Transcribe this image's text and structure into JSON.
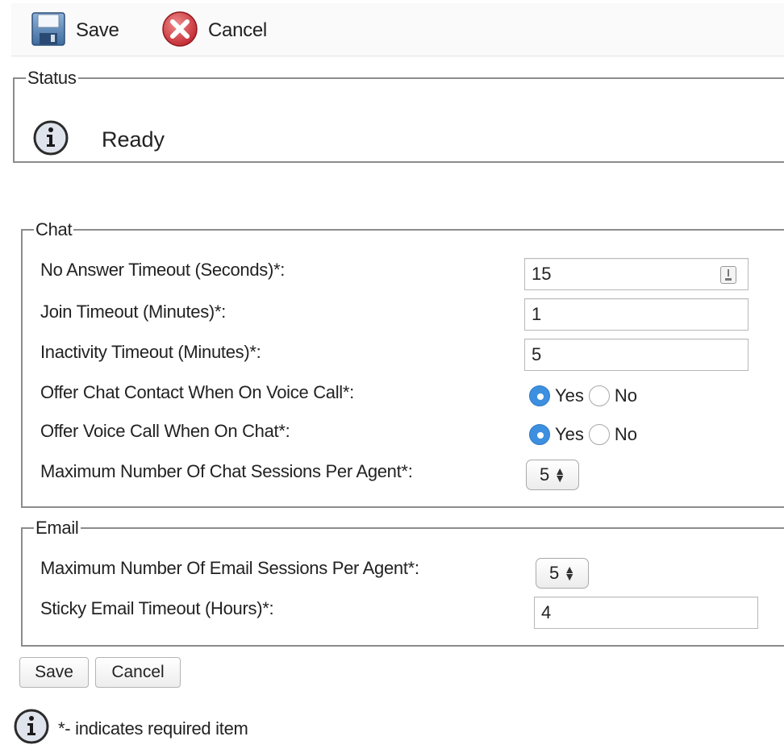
{
  "toolbar": {
    "save_label": "Save",
    "cancel_label": "Cancel"
  },
  "status": {
    "legend": "Status",
    "text": "Ready"
  },
  "chat": {
    "legend": "Chat",
    "no_answer_label": "No Answer Timeout (Seconds)*:",
    "no_answer_value": "15",
    "join_label": "Join Timeout (Minutes)*:",
    "join_value": "1",
    "inactivity_label": "Inactivity Timeout (Minutes)*:",
    "inactivity_value": "5",
    "offer_chat_label": "Offer Chat Contact When On Voice Call*:",
    "offer_voice_label": "Offer Voice Call When On Chat*:",
    "yes_label": "Yes",
    "no_label": "No",
    "max_sessions_label": "Maximum Number Of Chat Sessions Per Agent*:",
    "max_sessions_value": "5"
  },
  "email": {
    "legend": "Email",
    "max_sessions_label": "Maximum Number Of Email Sessions Per Agent*:",
    "max_sessions_value": "5",
    "sticky_label": "Sticky Email Timeout (Hours)*:",
    "sticky_value": "4"
  },
  "buttons": {
    "save_label": "Save",
    "cancel_label": "Cancel"
  },
  "footer": {
    "note": "*- indicates required item"
  },
  "colors": {
    "radio_selected": "#3d8fe0",
    "cancel_icon": "#d0333a",
    "info_icon_fill": "#dfe3ec"
  }
}
